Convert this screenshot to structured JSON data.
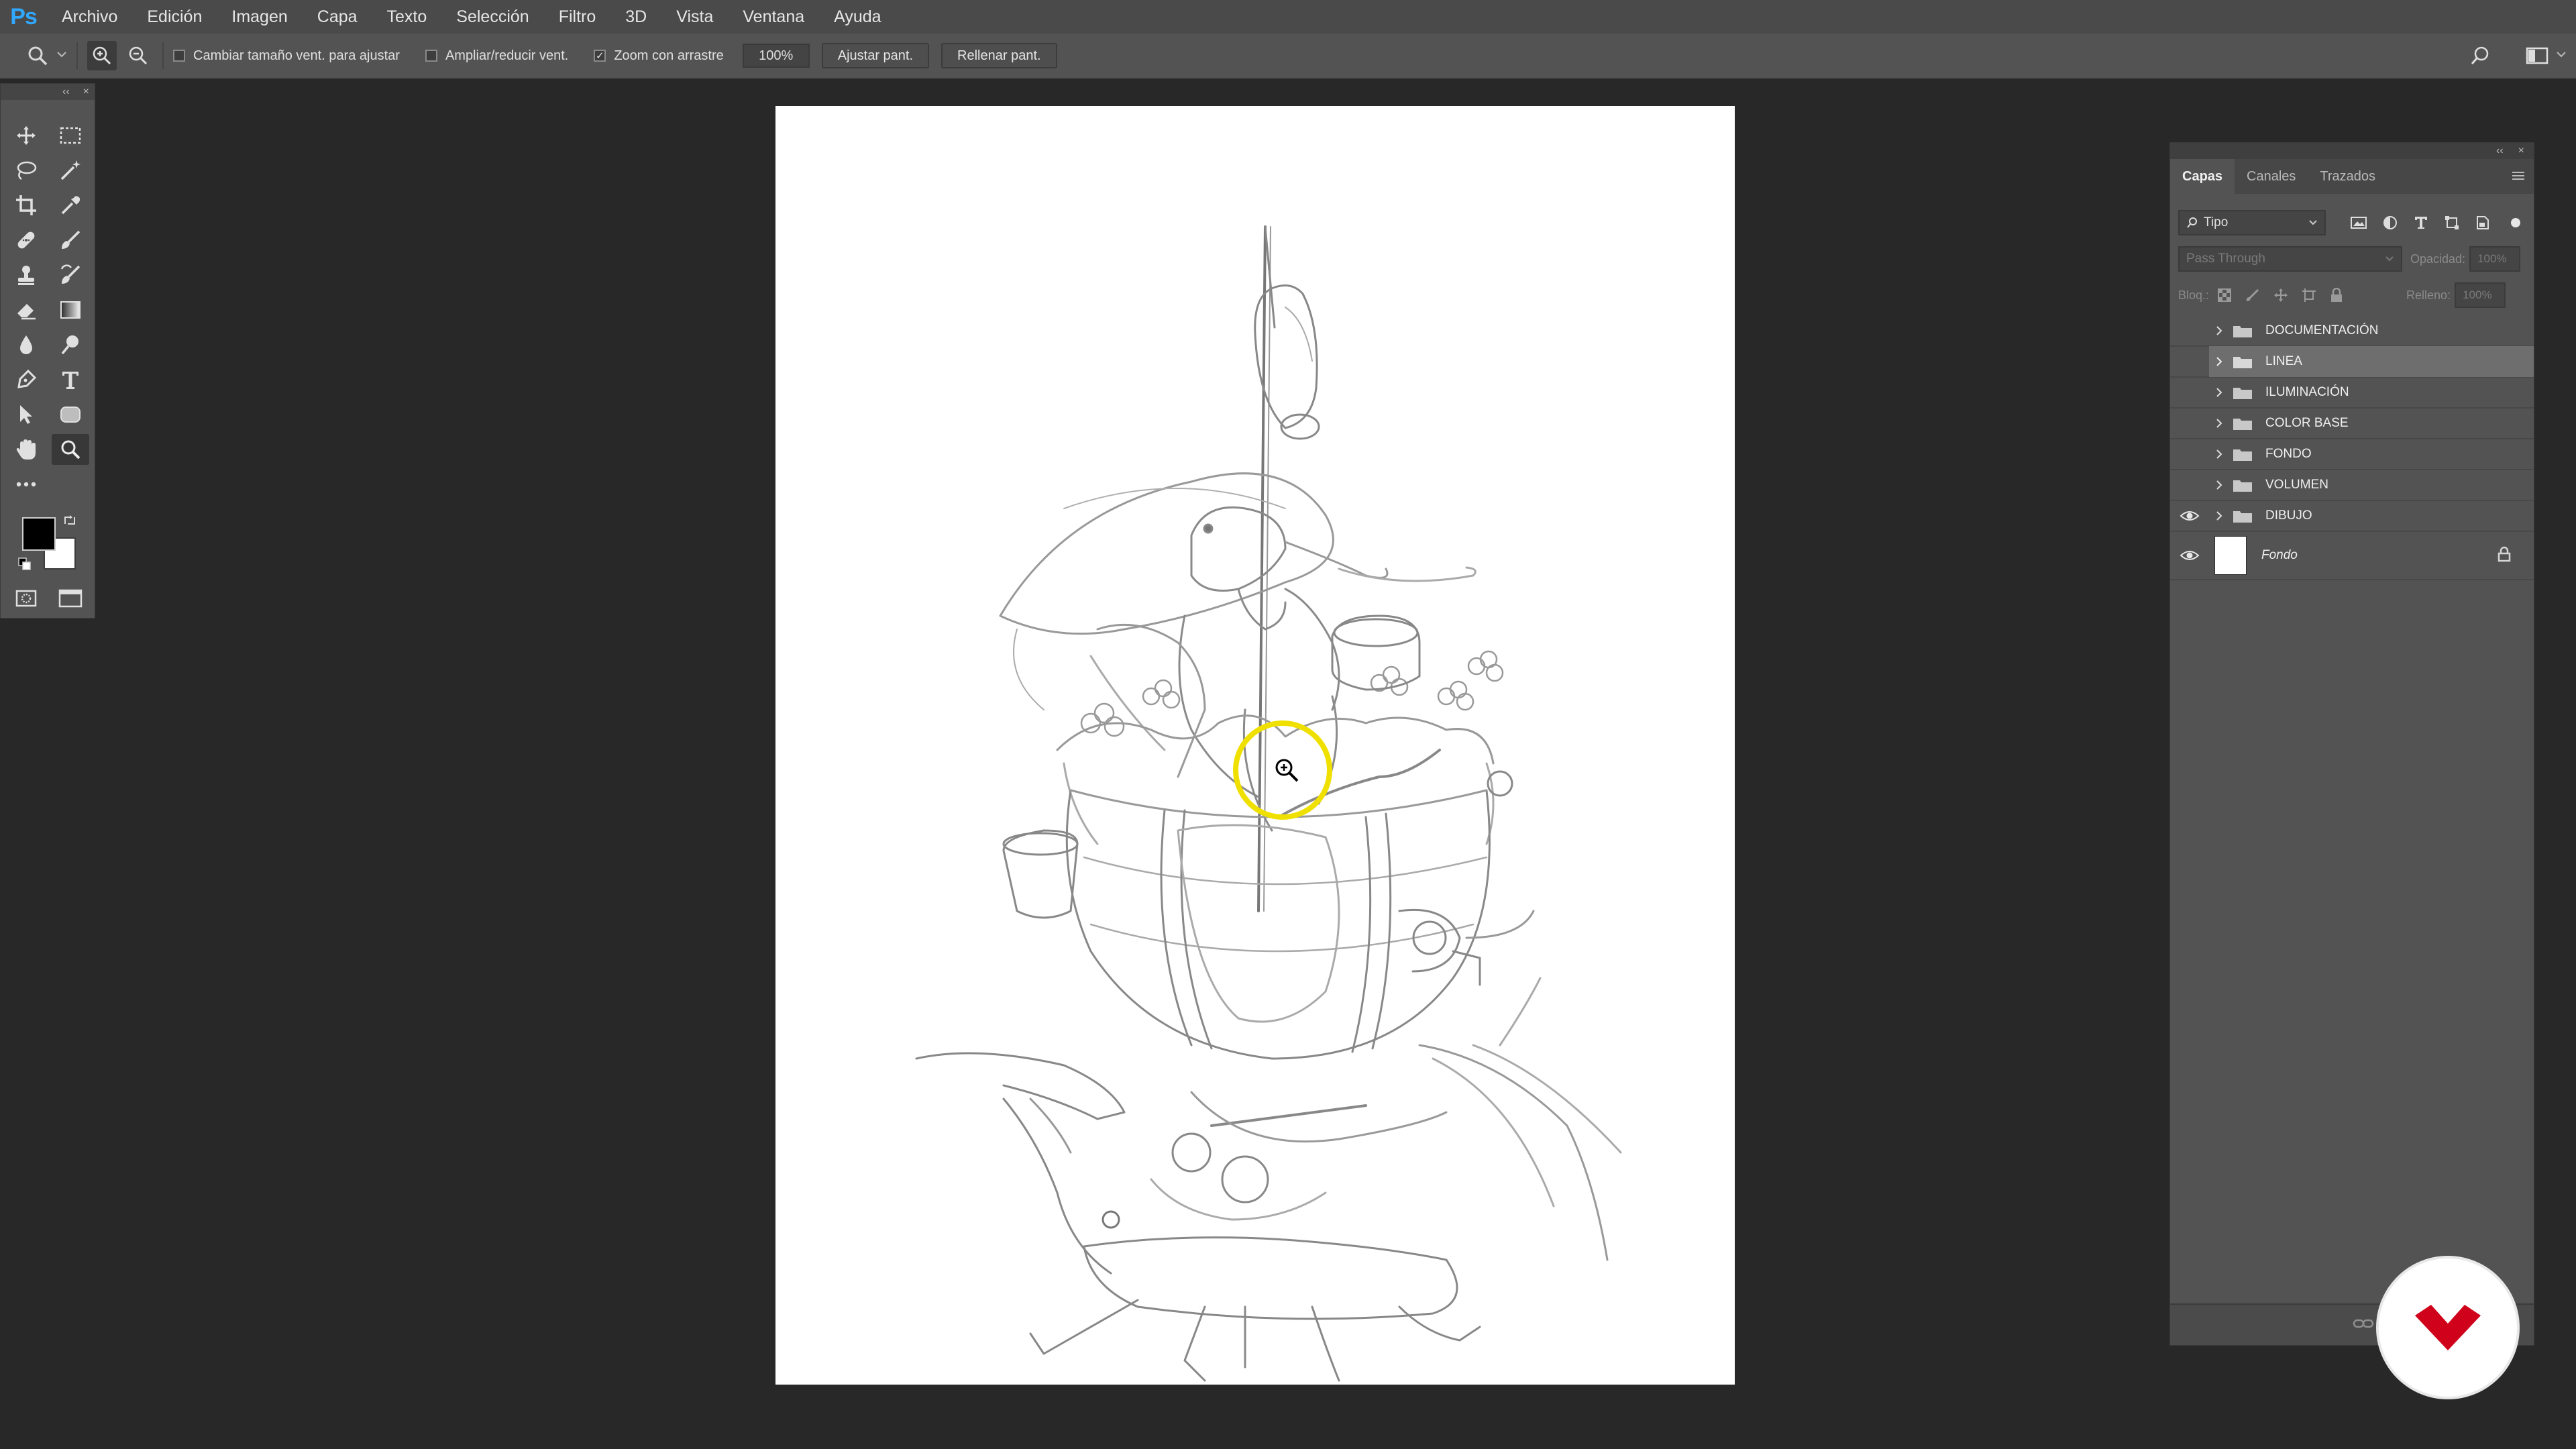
{
  "app": {
    "logo": "Ps",
    "menu": [
      "Archivo",
      "Edición",
      "Imagen",
      "Capa",
      "Texto",
      "Selección",
      "Filtro",
      "3D",
      "Vista",
      "Ventana",
      "Ayuda"
    ]
  },
  "options_bar": {
    "tool_icon": "zoom-icon",
    "checkbox_resize": {
      "label": "Cambiar tamaño vent. para ajustar",
      "checked": false
    },
    "checkbox_zoom_all": {
      "label": "Ampliar/reducir vent.",
      "checked": false
    },
    "checkbox_scrubby": {
      "label": "Zoom con arrastre",
      "checked": true
    },
    "zoom_value": "100%",
    "fit_screen_label": "Ajustar pant.",
    "fill_screen_label": "Rellenar pant."
  },
  "toolbar": {
    "tools": [
      "move-icon",
      "marquee-icon",
      "lasso-icon",
      "magic-wand-icon",
      "crop-icon",
      "eyedropper-icon",
      "healing-brush-icon",
      "brush-icon",
      "stamp-icon",
      "history-brush-icon",
      "eraser-icon",
      "gradient-icon",
      "blur-icon",
      "dodge-icon",
      "pen-icon",
      "type-icon",
      "path-select-icon",
      "shape-icon",
      "hand-icon",
      "zoom-icon",
      "more-icon"
    ],
    "active_tool": "zoom-icon",
    "foreground_color": "#000000",
    "background_color": "#ffffff"
  },
  "layers_panel": {
    "tabs": [
      "Capas",
      "Canales",
      "Trazados"
    ],
    "active_tab": "Capas",
    "filter_kind": "Tipo",
    "blend_mode": "Pass Through",
    "opacity_label": "Opacidad:",
    "opacity_value": "100%",
    "lock_label": "Bloq.:",
    "fill_label": "Relleno:",
    "fill_value": "100%",
    "layers": [
      {
        "name": "DOCUMENTACIÓN",
        "visible": false,
        "type": "group"
      },
      {
        "name": "LINEA",
        "visible": false,
        "type": "group",
        "selected": true
      },
      {
        "name": "ILUMINACIÓN",
        "visible": false,
        "type": "group"
      },
      {
        "name": "COLOR BASE",
        "visible": false,
        "type": "group"
      },
      {
        "name": "FONDO",
        "visible": false,
        "type": "group"
      },
      {
        "name": "VOLUMEN",
        "visible": false,
        "type": "group"
      },
      {
        "name": "DIBUJO",
        "visible": true,
        "type": "group"
      },
      {
        "name": "Fondo",
        "visible": true,
        "type": "background",
        "locked": true
      }
    ],
    "bottom_icons": [
      "link-icon",
      "fx-icon",
      "mask-icon"
    ]
  },
  "brand": {
    "icon": "brand-logo-icon",
    "color": "#d0021b"
  },
  "colors": {
    "accent": "#31a8ff",
    "cursor_highlight": "#f0e000"
  }
}
